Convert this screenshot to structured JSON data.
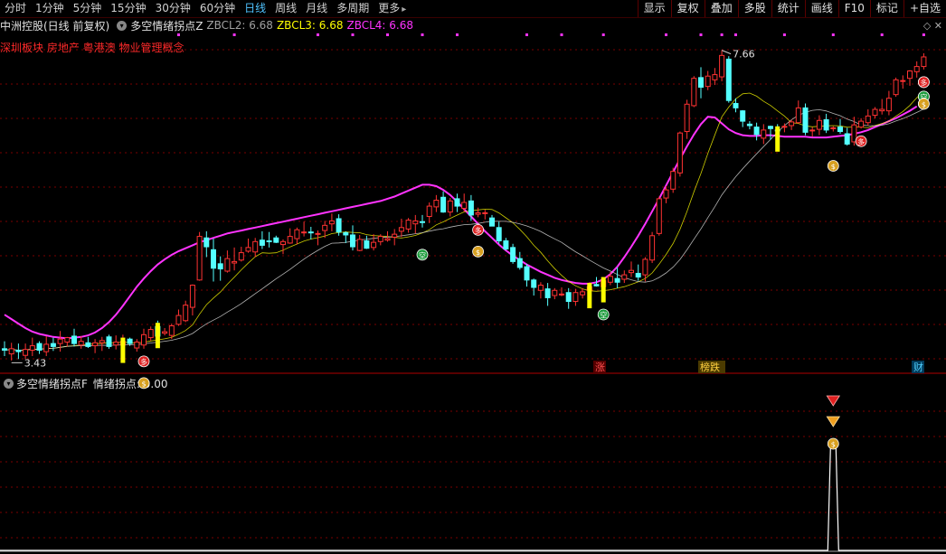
{
  "tabs": [
    {
      "label": "分时",
      "active": false
    },
    {
      "label": "1分钟",
      "active": false
    },
    {
      "label": "5分钟",
      "active": false
    },
    {
      "label": "15分钟",
      "active": false
    },
    {
      "label": "30分钟",
      "active": false
    },
    {
      "label": "60分钟",
      "active": false
    },
    {
      "label": "日线",
      "active": true
    },
    {
      "label": "周线",
      "active": false
    },
    {
      "label": "月线",
      "active": false
    },
    {
      "label": "多周期",
      "active": false
    },
    {
      "label": "更多",
      "active": false,
      "arrow": true
    }
  ],
  "menus": [
    "显示",
    "复权",
    "叠加",
    "多股",
    "统计",
    "画线",
    "F10",
    "标记",
    "+自选"
  ],
  "info": {
    "stock": "中洲控股(日线 前复权)",
    "indicator": "多空情绪拐点Z",
    "zbcl2": "ZBCL2: 6.68",
    "zbcl3": "ZBCL3: 6.68",
    "zbcl4": "ZBCL4: 6.68"
  },
  "sectors": "深圳板块 房地产 粤港澳 物业管理概念",
  "sub": {
    "indicator": "多空情绪拐点F",
    "value": "情绪拐点: 0.00"
  },
  "labels": {
    "high": "7.66",
    "low": "3.43",
    "tag_zhang": "涨",
    "tag_bangdie": "榜跌",
    "tag_cai": "财",
    "duo": "多",
    "kong": "空",
    "money": "$"
  },
  "colors": {
    "up": "#ff3232",
    "down": "#54ffff",
    "magenta_ma": "#ff33ff",
    "yellow_ma": "#ffff00",
    "white_ma": "#e0e0e0",
    "grid": "#7a0000",
    "signal_yellow": "#ffff00"
  },
  "chart_data": {
    "type": "candlestick",
    "title": "中洲控股(日线 前复权)",
    "price_high": 7.66,
    "price_low": 3.43,
    "ylim": [
      3.3,
      7.9
    ],
    "magenta_line": [
      4.08,
      4.02,
      3.96,
      3.9,
      3.85,
      3.82,
      3.8,
      3.78,
      3.77,
      3.76,
      3.77,
      3.78,
      3.8,
      3.84,
      3.9,
      3.98,
      4.08,
      4.2,
      4.33,
      4.46,
      4.57,
      4.67,
      4.76,
      4.83,
      4.89,
      4.94,
      4.98,
      5.02,
      5.06,
      5.09,
      5.12,
      5.15,
      5.18,
      5.2,
      5.22,
      5.24,
      5.26,
      5.28,
      5.3,
      5.32,
      5.34,
      5.36,
      5.38,
      5.4,
      5.42,
      5.44,
      5.46,
      5.48,
      5.5,
      5.52,
      5.54,
      5.56,
      5.58,
      5.6,
      5.62,
      5.65,
      5.68,
      5.72,
      5.76,
      5.8,
      5.84,
      5.84,
      5.82,
      5.77,
      5.7,
      5.61,
      5.51,
      5.41,
      5.31,
      5.21,
      5.12,
      5.03,
      4.95,
      4.88,
      4.82,
      4.76,
      4.71,
      4.66,
      4.62,
      4.58,
      4.55,
      4.53,
      4.51,
      4.5,
      4.5,
      4.52,
      4.56,
      4.63,
      4.73,
      4.86,
      5.0,
      5.15,
      5.31,
      5.48,
      5.65,
      5.83,
      6.01,
      6.19,
      6.36,
      6.52,
      6.66,
      6.76,
      6.75,
      6.67,
      6.59,
      6.54,
      6.51,
      6.5,
      6.5,
      6.51,
      6.51,
      6.5,
      6.49,
      6.49,
      6.49,
      6.49,
      6.48,
      6.48,
      6.48,
      6.49,
      6.5,
      6.51,
      6.53,
      6.55,
      6.58,
      6.62,
      6.66,
      6.7,
      6.74,
      6.79,
      6.84,
      6.9
    ],
    "candles": [
      [
        3.62,
        3.6,
        3.72,
        3.52
      ],
      [
        3.55,
        3.62,
        3.7,
        3.46
      ],
      [
        3.6,
        3.58,
        3.69,
        3.48
      ],
      [
        3.53,
        3.61,
        3.69,
        3.48
      ],
      [
        3.6,
        3.66,
        3.77,
        3.52
      ],
      [
        3.69,
        3.6,
        3.72,
        3.55
      ],
      [
        3.58,
        3.68,
        3.79,
        3.52
      ],
      [
        3.69,
        3.65,
        3.77,
        3.59
      ],
      [
        3.69,
        3.75,
        3.86,
        3.58
      ],
      [
        3.71,
        3.77,
        3.78,
        3.65
      ],
      [
        3.79,
        3.69,
        3.89,
        3.65
      ],
      [
        3.67,
        3.72,
        3.79,
        3.62
      ],
      [
        3.7,
        3.65,
        3.78,
        3.63
      ],
      [
        3.66,
        3.7,
        3.75,
        3.56
      ],
      [
        3.7,
        3.73,
        3.78,
        3.59
      ],
      [
        3.78,
        3.65,
        3.81,
        3.62
      ],
      [
        3.67,
        3.71,
        3.8,
        3.61
      ],
      [
        3.67,
        3.72,
        3.81,
        3.64
      ],
      [
        3.75,
        3.69,
        3.77,
        3.66
      ],
      [
        3.63,
        3.71,
        3.75,
        3.58
      ],
      [
        3.67,
        3.81,
        3.89,
        3.62
      ],
      [
        3.77,
        3.88,
        3.92,
        3.73
      ],
      [
        3.92,
        3.79,
        4.0,
        3.7
      ],
      [
        3.83,
        3.85,
        3.9,
        3.8
      ],
      [
        3.8,
        3.93,
        3.96,
        3.75
      ],
      [
        3.95,
        4.07,
        4.15,
        3.93
      ],
      [
        4.0,
        4.21,
        4.27,
        3.98
      ],
      [
        4.18,
        4.48,
        4.49,
        4.07
      ],
      [
        4.55,
        5.14,
        5.2,
        4.54
      ],
      [
        5.12,
        5.0,
        5.21,
        4.86
      ],
      [
        4.96,
        4.71,
        5.11,
        4.53
      ],
      [
        4.77,
        4.7,
        4.87,
        4.54
      ],
      [
        4.67,
        4.84,
        4.95,
        4.65
      ],
      [
        4.78,
        4.8,
        4.99,
        4.68
      ],
      [
        4.82,
        4.92,
        5.0,
        4.8
      ],
      [
        4.94,
        4.99,
        5.11,
        4.92
      ],
      [
        4.93,
        5.07,
        5.12,
        4.86
      ],
      [
        5.09,
        5.02,
        5.21,
        4.97
      ],
      [
        5.08,
        5.07,
        5.2,
        4.99
      ],
      [
        5.12,
        5.06,
        5.15,
        5.05
      ],
      [
        5.03,
        5.07,
        5.1,
        4.9
      ],
      [
        5.05,
        5.14,
        5.25,
        5.04
      ],
      [
        5.11,
        5.23,
        5.26,
        5.03
      ],
      [
        5.2,
        5.2,
        5.34,
        5.14
      ],
      [
        5.2,
        5.19,
        5.27,
        5.1
      ],
      [
        5.17,
        5.18,
        5.22,
        5.02
      ],
      [
        5.22,
        5.29,
        5.35,
        5.12
      ],
      [
        5.31,
        5.35,
        5.45,
        5.21
      ],
      [
        5.38,
        5.2,
        5.44,
        5.15
      ],
      [
        5.19,
        5.16,
        5.21,
        5.05
      ],
      [
        5.16,
        5.0,
        5.29,
        4.95
      ],
      [
        4.95,
        5.1,
        5.16,
        4.94
      ],
      [
        5.08,
        4.98,
        5.15,
        4.97
      ],
      [
        4.99,
        5.06,
        5.17,
        4.95
      ],
      [
        5.07,
        5.14,
        5.17,
        5.02
      ],
      [
        5.09,
        5.11,
        5.21,
        5.07
      ],
      [
        5.13,
        5.17,
        5.24,
        5.02
      ],
      [
        5.21,
        5.26,
        5.38,
        5.13
      ],
      [
        5.24,
        5.36,
        5.39,
        5.19
      ],
      [
        5.31,
        5.35,
        5.43,
        5.18
      ],
      [
        5.34,
        5.33,
        5.43,
        5.26
      ],
      [
        5.41,
        5.55,
        5.6,
        5.32
      ],
      [
        5.54,
        5.63,
        5.7,
        5.47
      ],
      [
        5.67,
        5.47,
        5.75,
        5.46
      ],
      [
        5.47,
        5.62,
        5.66,
        5.41
      ],
      [
        5.65,
        5.55,
        5.72,
        5.47
      ],
      [
        5.52,
        5.6,
        5.72,
        5.47
      ],
      [
        5.62,
        5.43,
        5.7,
        5.35
      ],
      [
        5.44,
        5.46,
        5.53,
        5.4
      ],
      [
        5.46,
        5.46,
        5.5,
        5.37
      ],
      [
        5.39,
        5.28,
        5.43,
        5.28
      ],
      [
        5.26,
        5.08,
        5.34,
        5.04
      ],
      [
        5.08,
        4.97,
        5.12,
        4.95
      ],
      [
        4.99,
        4.8,
        5.04,
        4.77
      ],
      [
        4.84,
        4.72,
        4.93,
        4.69
      ],
      [
        4.73,
        4.55,
        4.77,
        4.46
      ],
      [
        4.55,
        4.45,
        4.57,
        4.34
      ],
      [
        4.41,
        4.48,
        4.52,
        4.3
      ],
      [
        4.43,
        4.31,
        4.51,
        4.2
      ],
      [
        4.34,
        4.41,
        4.44,
        4.29
      ],
      [
        4.35,
        4.36,
        4.45,
        4.33
      ],
      [
        4.38,
        4.26,
        4.44,
        4.16
      ],
      [
        4.26,
        4.38,
        4.43,
        4.2
      ],
      [
        4.35,
        4.39,
        4.44,
        4.3
      ],
      [
        4.41,
        4.46,
        4.52,
        4.35
      ],
      [
        4.49,
        4.47,
        4.59,
        4.46
      ],
      [
        4.46,
        4.54,
        4.56,
        4.45
      ],
      [
        4.52,
        4.6,
        4.66,
        4.48
      ],
      [
        4.57,
        4.52,
        4.72,
        4.44
      ],
      [
        4.56,
        4.62,
        4.68,
        4.51
      ],
      [
        4.65,
        4.68,
        4.8,
        4.59
      ],
      [
        4.64,
        4.59,
        4.76,
        4.54
      ],
      [
        4.62,
        4.83,
        4.86,
        4.53
      ],
      [
        4.82,
        5.15,
        5.2,
        4.78
      ],
      [
        5.18,
        5.65,
        5.68,
        5.15
      ],
      [
        5.66,
        5.77,
        5.82,
        5.59
      ],
      [
        5.78,
        6.02,
        6.07,
        5.73
      ],
      [
        6.0,
        6.54,
        6.56,
        5.95
      ],
      [
        6.56,
        6.93,
        6.99,
        6.46
      ],
      [
        6.91,
        7.28,
        7.31,
        6.89
      ],
      [
        7.29,
        7.16,
        7.43,
        7.01
      ],
      [
        7.17,
        7.31,
        7.38,
        7.12
      ],
      [
        7.26,
        7.33,
        7.42,
        7.19
      ],
      [
        7.3,
        7.59,
        7.66,
        7.24
      ],
      [
        7.54,
        6.98,
        7.58,
        6.95
      ],
      [
        6.94,
        6.88,
        7.01,
        6.82
      ],
      [
        6.84,
        6.7,
        6.85,
        6.62
      ],
      [
        6.66,
        6.64,
        6.7,
        6.59
      ],
      [
        6.62,
        6.52,
        6.68,
        6.44
      ],
      [
        6.47,
        6.58,
        6.66,
        6.39
      ],
      [
        6.63,
        6.6,
        6.64,
        6.45
      ],
      [
        6.58,
        6.57,
        6.66,
        6.53
      ],
      [
        6.63,
        6.63,
        6.67,
        6.55
      ],
      [
        6.64,
        6.69,
        6.72,
        6.58
      ],
      [
        6.68,
        6.88,
        6.98,
        6.67
      ],
      [
        6.88,
        6.55,
        6.94,
        6.51
      ],
      [
        6.57,
        6.58,
        6.62,
        6.49
      ],
      [
        6.59,
        6.71,
        6.78,
        6.51
      ],
      [
        6.72,
        6.58,
        6.8,
        6.54
      ],
      [
        6.6,
        6.61,
        6.63,
        6.56
      ],
      [
        6.62,
        6.56,
        6.73,
        6.53
      ],
      [
        6.53,
        6.39,
        6.61,
        6.37
      ],
      [
        6.42,
        6.65,
        6.76,
        6.37
      ],
      [
        6.62,
        6.7,
        6.74,
        6.6
      ],
      [
        6.68,
        6.77,
        6.86,
        6.64
      ],
      [
        6.78,
        6.86,
        6.89,
        6.74
      ],
      [
        6.84,
        6.86,
        7.0,
        6.79
      ],
      [
        6.84,
        7.01,
        7.11,
        6.78
      ],
      [
        7.06,
        7.26,
        7.29,
        7.03
      ],
      [
        7.25,
        7.25,
        7.32,
        7.14
      ],
      [
        7.28,
        7.38,
        7.39,
        7.18
      ],
      [
        7.37,
        7.44,
        7.51,
        7.29
      ],
      [
        7.44,
        7.57,
        7.62,
        7.4
      ]
    ],
    "signals": {
      "duo": [
        20,
        68,
        123,
        162,
        181
      ],
      "kong": [
        60,
        86,
        143,
        157
      ],
      "money": [
        20,
        68,
        119,
        155,
        177
      ]
    },
    "sub_chart": {
      "title": "多空情绪拐点F",
      "value_label": "情绪拐点: 0.00",
      "spike_index": 119,
      "ylim": [
        0,
        1
      ]
    }
  }
}
